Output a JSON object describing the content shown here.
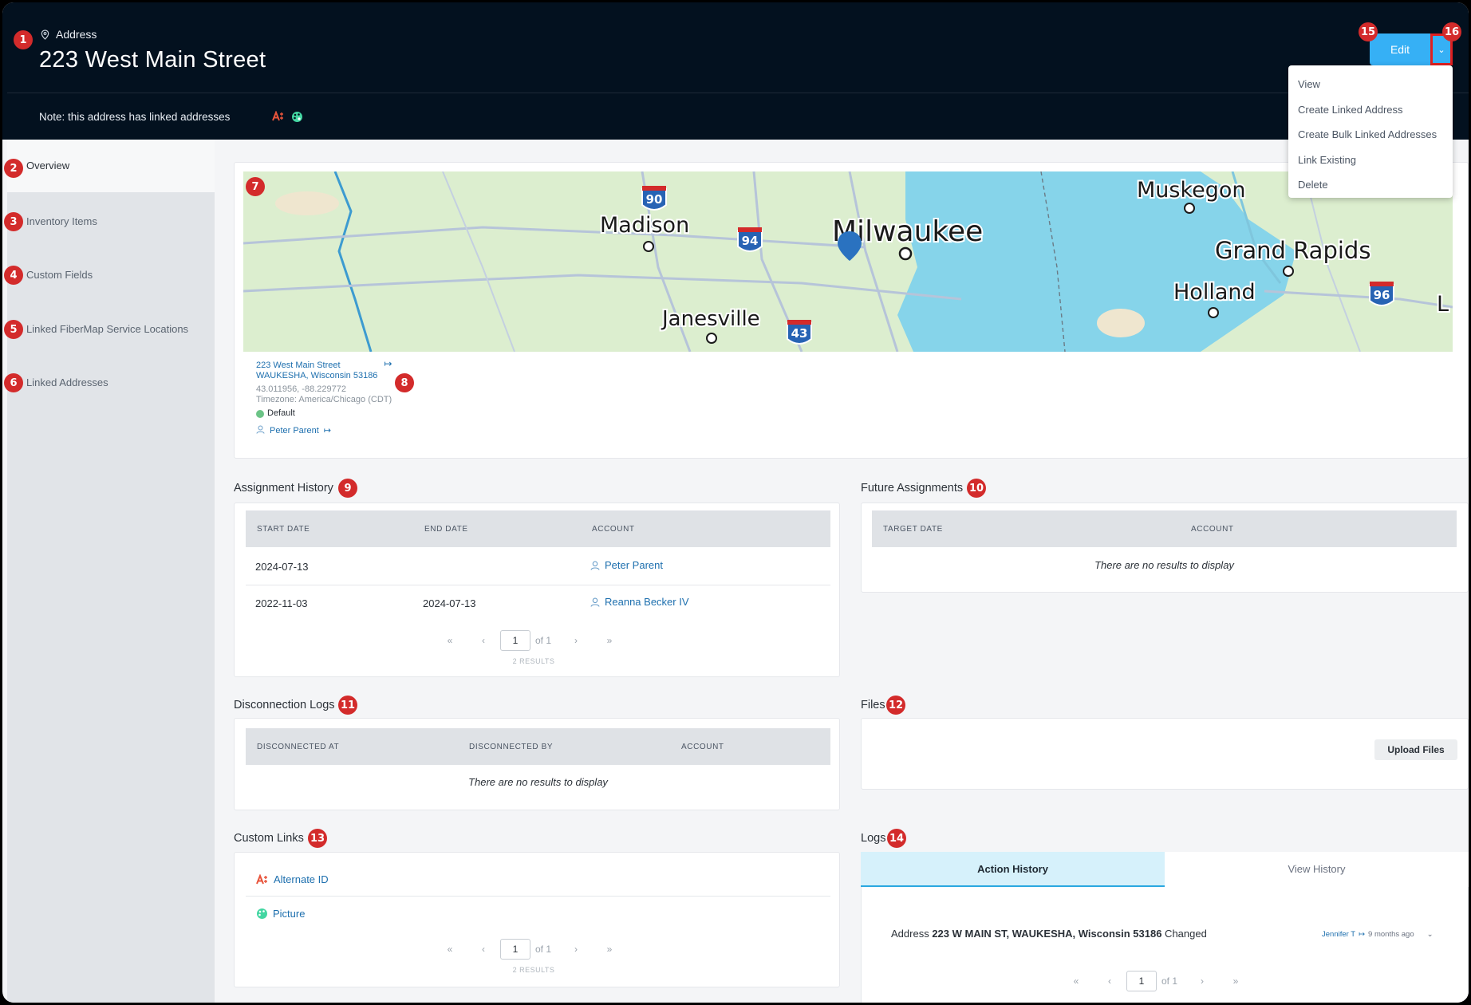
{
  "header": {
    "breadcrumb": "Address",
    "title": "223 West Main Street",
    "note": "Note: this address has linked addresses",
    "edit_label": "Edit"
  },
  "dropdown": {
    "items": [
      "View",
      "Create Linked Address",
      "Create Bulk Linked Addresses",
      "Link Existing",
      "Delete"
    ]
  },
  "sidebar": {
    "items": [
      "Overview",
      "Inventory Items",
      "Custom Fields",
      "Linked FiberMap Service Locations",
      "Linked Addresses"
    ]
  },
  "markers": [
    "1",
    "2",
    "3",
    "4",
    "5",
    "6",
    "7",
    "8",
    "9",
    "10",
    "11",
    "12",
    "13",
    "14",
    "15",
    "16"
  ],
  "map": {
    "cities": [
      "Madison",
      "Milwaukee",
      "Muskegon",
      "Grand Rapids",
      "Holland",
      "Janesville",
      "L"
    ],
    "highways": [
      "90",
      "94",
      "43",
      "96"
    ]
  },
  "address": {
    "line1": "223 West Main Street",
    "line2": "WAUKESHA, Wisconsin 53186",
    "coords": "43.011956, -88.229772",
    "timezone": "Timezone: America/Chicago (CDT)",
    "status": "Default",
    "owner": "Peter Parent",
    "status_color": "#6cc487"
  },
  "assignment_history": {
    "title": "Assignment History",
    "columns": [
      "START DATE",
      "END DATE",
      "ACCOUNT"
    ],
    "rows": [
      {
        "start": "2024-07-13",
        "end": "",
        "account": "Peter Parent"
      },
      {
        "start": "2022-11-03",
        "end": "2024-07-13",
        "account": "Reanna Becker IV"
      }
    ],
    "page": "1",
    "of": "of 1",
    "results": "2 RESULTS"
  },
  "future_assignments": {
    "title": "Future Assignments",
    "columns": [
      "TARGET DATE",
      "ACCOUNT"
    ],
    "empty": "There are no results to display"
  },
  "disconnection_logs": {
    "title": "Disconnection Logs",
    "columns": [
      "DISCONNECTED AT",
      "DISCONNECTED BY",
      "ACCOUNT"
    ],
    "empty": "There are no results to display"
  },
  "files": {
    "title": "Files",
    "upload_label": "Upload Files"
  },
  "custom_links": {
    "title": "Custom Links",
    "items": [
      "Alternate ID",
      "Picture"
    ],
    "page": "1",
    "of": "of 1",
    "results": "2 RESULTS"
  },
  "logs": {
    "title": "Logs",
    "tabs": [
      "Action History",
      "View History"
    ],
    "entry_prefix": "Address ",
    "entry_bold": "223 W MAIN ST, WAUKESHA, Wisconsin 53186",
    "entry_suffix": " Changed",
    "user": "Jennifer T",
    "ago": "9 months ago",
    "page": "1",
    "of": "of 1"
  },
  "colors": {
    "header_bg": "#03111f",
    "accent": "#36b0f5",
    "marker": "#d32b2b",
    "link": "#1d6fae"
  }
}
